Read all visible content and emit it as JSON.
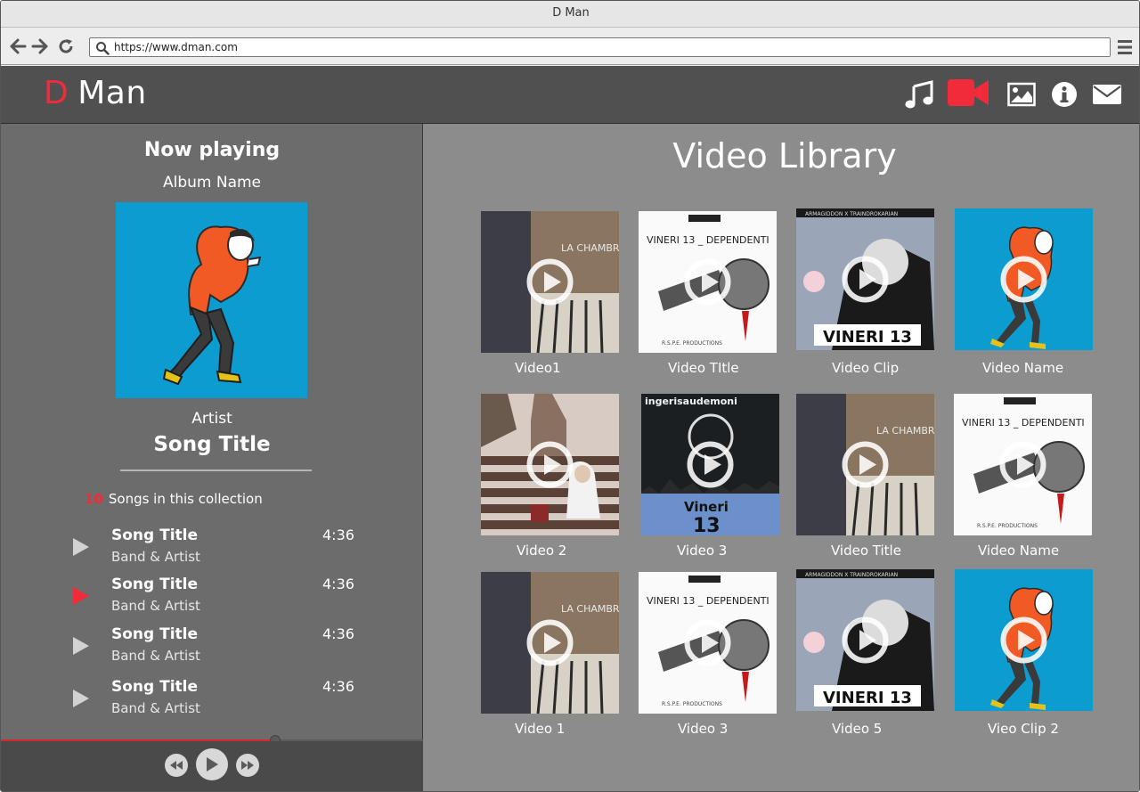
{
  "browser": {
    "title": "D Man",
    "url": "https://www.dman.com"
  },
  "header": {
    "logo_letter": "D",
    "logo_rest": "Man",
    "nav_icons": [
      "music-icon",
      "video-camera-icon",
      "image-icon",
      "info-icon",
      "mail-icon"
    ],
    "active_icon": "video-camera-icon",
    "accent_color": "#f12b3a"
  },
  "now_playing": {
    "heading": "Now playing",
    "album": "Album Name",
    "artist": "Artist",
    "song": "Song Title",
    "collection_count": "10",
    "collection_label": "Songs in this collection"
  },
  "playlist": [
    {
      "title": "Song Title",
      "band": "Band & Artist",
      "duration": "4:36",
      "active": false
    },
    {
      "title": "Song Title",
      "band": "Band & Artist",
      "duration": "4:36",
      "active": true
    },
    {
      "title": "Song Title",
      "band": "Band & Artist",
      "duration": "4:36",
      "active": false
    },
    {
      "title": "Song Title",
      "band": "Band & Artist",
      "duration": "4:36",
      "active": false
    }
  ],
  "player": {
    "progress": 0.65,
    "controls": [
      "rewind-icon",
      "play-icon",
      "fast-forward-icon"
    ]
  },
  "library": {
    "title": "Video Library",
    "videos": [
      {
        "caption": "Video1"
      },
      {
        "caption": "Video TItle"
      },
      {
        "caption": "Video Clip"
      },
      {
        "caption": "Video Name"
      },
      {
        "caption": "Video 2"
      },
      {
        "caption": "Video 3"
      },
      {
        "caption": "Video Title"
      },
      {
        "caption": "Video Name"
      },
      {
        "caption": "Video 1"
      },
      {
        "caption": "Video 3"
      },
      {
        "caption": "Video 5"
      },
      {
        "caption": "Vieo Clip 2"
      }
    ],
    "thumb_text": {
      "vineri_dep": "VINERI 13 _ DEPENDENTI",
      "vineri_13": "VINERI 13",
      "ingeri": "ingerisaudemoni",
      "vineri_word": "Vineri",
      "vineri_num": "13",
      "credit_top": "ARMAGIDDON  X TRAINDROKARIAN",
      "credit_small": "R.S.P.E. PRODUCTIONS",
      "piano_graffiti": "LA CHAMBRE"
    }
  }
}
